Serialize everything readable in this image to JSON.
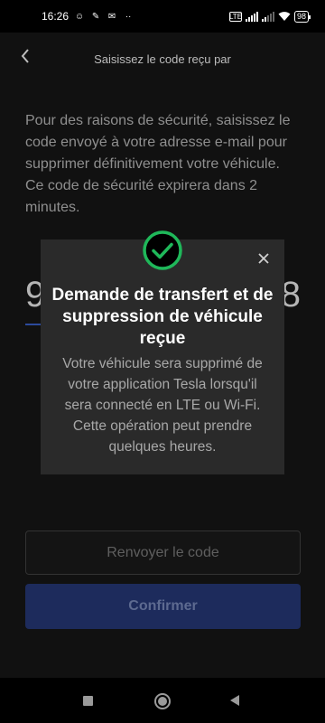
{
  "status_bar": {
    "time": "16:26",
    "battery": "98"
  },
  "header": {
    "title": "Saisissez le code reçu par",
    "back_icon": "chevron-left-icon"
  },
  "description": "Pour des raisons de sécurité, saisissez le code envoyé à votre adresse e-mail pour supprimer définitivement votre véhicule. Ce code de sécurité expirera dans 2 minutes.",
  "code": {
    "first_digit": "9",
    "last_digit": "8"
  },
  "buttons": {
    "resend": "Renvoyer le code",
    "confirm": "Confirmer"
  },
  "modal": {
    "title": "Demande de transfert et de suppression de véhicule reçue",
    "body": "Votre véhicule sera supprimé de votre application Tesla lorsqu'il sera connecté en LTE ou Wi-Fi. Cette opération peut prendre quelques heures.",
    "close_icon": "close-icon",
    "check_icon": "check-circle-icon"
  },
  "colors": {
    "accent_green": "#1fb85a",
    "confirm_button": "#1d2b5c",
    "modal_bg": "#2a2a2a"
  }
}
